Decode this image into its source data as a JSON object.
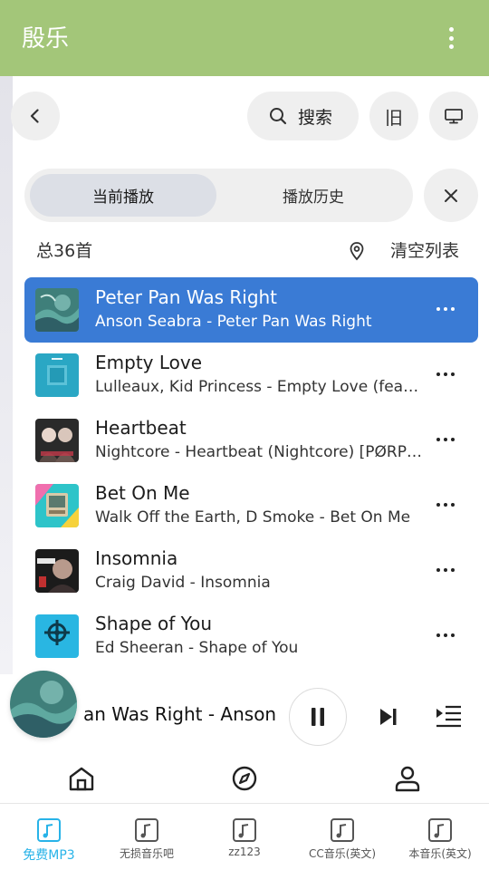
{
  "app": {
    "title": "殷乐"
  },
  "toolbar": {
    "search_label": "搜索",
    "old_label": "旧"
  },
  "tabs": [
    {
      "label": "当前播放",
      "active": true
    },
    {
      "label": "播放历史",
      "active": false
    }
  ],
  "list_header": {
    "total": "总36首",
    "clear_label": "清空列表"
  },
  "songs": [
    {
      "title": "Peter Pan Was Right",
      "subtitle": "Anson Seabra - Peter Pan Was Right",
      "current": true
    },
    {
      "title": "Empty Love",
      "subtitle": "Lulleaux, Kid Princess - Empty Love (feat. Kid Princess)",
      "current": false
    },
    {
      "title": "Heartbeat",
      "subtitle": "Nightcore - Heartbeat (Nightcore) [PØRP Remix]",
      "current": false
    },
    {
      "title": "Bet On Me",
      "subtitle": "Walk Off the Earth, D Smoke - Bet On Me",
      "current": false
    },
    {
      "title": "Insomnia",
      "subtitle": "Craig David - Insomnia",
      "current": false
    },
    {
      "title": "Shape of You",
      "subtitle": "Ed Sheeran - Shape of You",
      "current": false
    }
  ],
  "player": {
    "now_playing": "an Was Right - Anson Seabra"
  },
  "bottom_tabs": [
    {
      "label": "免费MP3",
      "active": true
    },
    {
      "label": "无损音乐吧",
      "active": false
    },
    {
      "label": "zz123",
      "active": false
    },
    {
      "label": "CC音乐(英文)",
      "active": false
    },
    {
      "label": "本音乐(英文)",
      "active": false
    }
  ],
  "colors": {
    "app_bar": "#a3c679",
    "current_row": "#3a7bd5",
    "active_tab_accent": "#28b3e8",
    "pill_bg": "#efefef"
  },
  "icons": {
    "menu": "more-vert-icon",
    "back": "chevron-left-icon",
    "search": "search-icon",
    "tv": "tv-icon",
    "close": "close-icon",
    "locate": "location-pin-icon",
    "pause": "pause-icon",
    "next": "skip-next-icon",
    "queue": "queue-list-icon",
    "home": "home-icon",
    "discover": "compass-icon",
    "profile": "person-icon",
    "music": "music-note-icon"
  }
}
